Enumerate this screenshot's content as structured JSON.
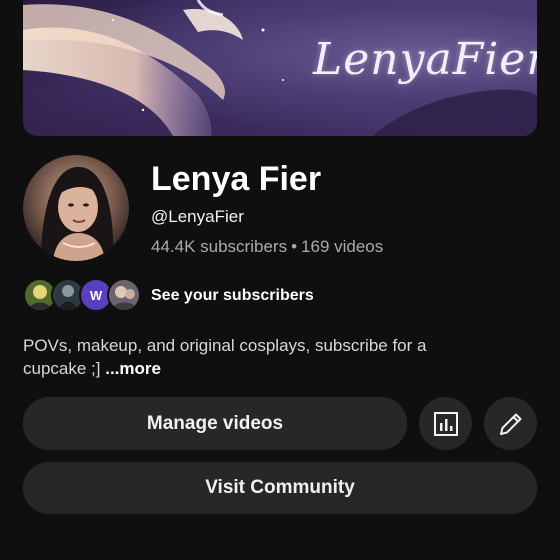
{
  "banner": {
    "script_text": "LenyaFier"
  },
  "channel": {
    "name": "Lenya Fier",
    "handle": "@LenyaFier",
    "subscribers": "44.4K subscribers",
    "separator": "•",
    "videos": "169 videos"
  },
  "subscribers_row": {
    "avatars": [
      "subscriber-avatar-1",
      "subscriber-avatar-2",
      "W",
      "subscriber-avatar-4"
    ],
    "label": "See your subscribers"
  },
  "description": {
    "text": "POVs, makeup, and original cosplays, subscribe for a cupcake ;]",
    "more_label": "...more"
  },
  "actions": {
    "manage_videos": "Manage videos",
    "analytics_icon": "analytics-icon",
    "edit_icon": "pencil-icon",
    "visit_community": "Visit Community"
  }
}
